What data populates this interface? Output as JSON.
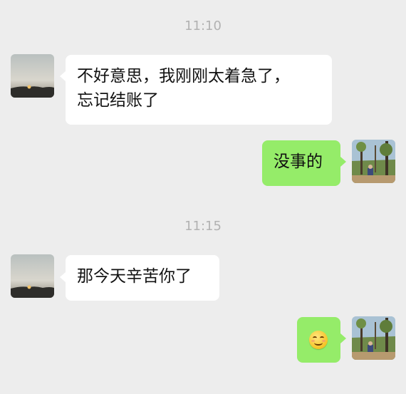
{
  "chat": {
    "timestamps": [
      "11:10",
      "11:15"
    ],
    "messages": [
      {
        "side": "left",
        "text_lines": [
          "不好意思，我刚刚太着急了，",
          "忘记结账了"
        ]
      },
      {
        "side": "right",
        "text": "没事的"
      },
      {
        "side": "left",
        "text": "那今天辛苦你了"
      },
      {
        "side": "right",
        "emoji": "smiling-face-emoji"
      }
    ]
  },
  "colors": {
    "background": "#ededed",
    "incoming_bubble": "#ffffff",
    "outgoing_bubble": "#95ec69",
    "timestamp": "#b2b2b2"
  }
}
